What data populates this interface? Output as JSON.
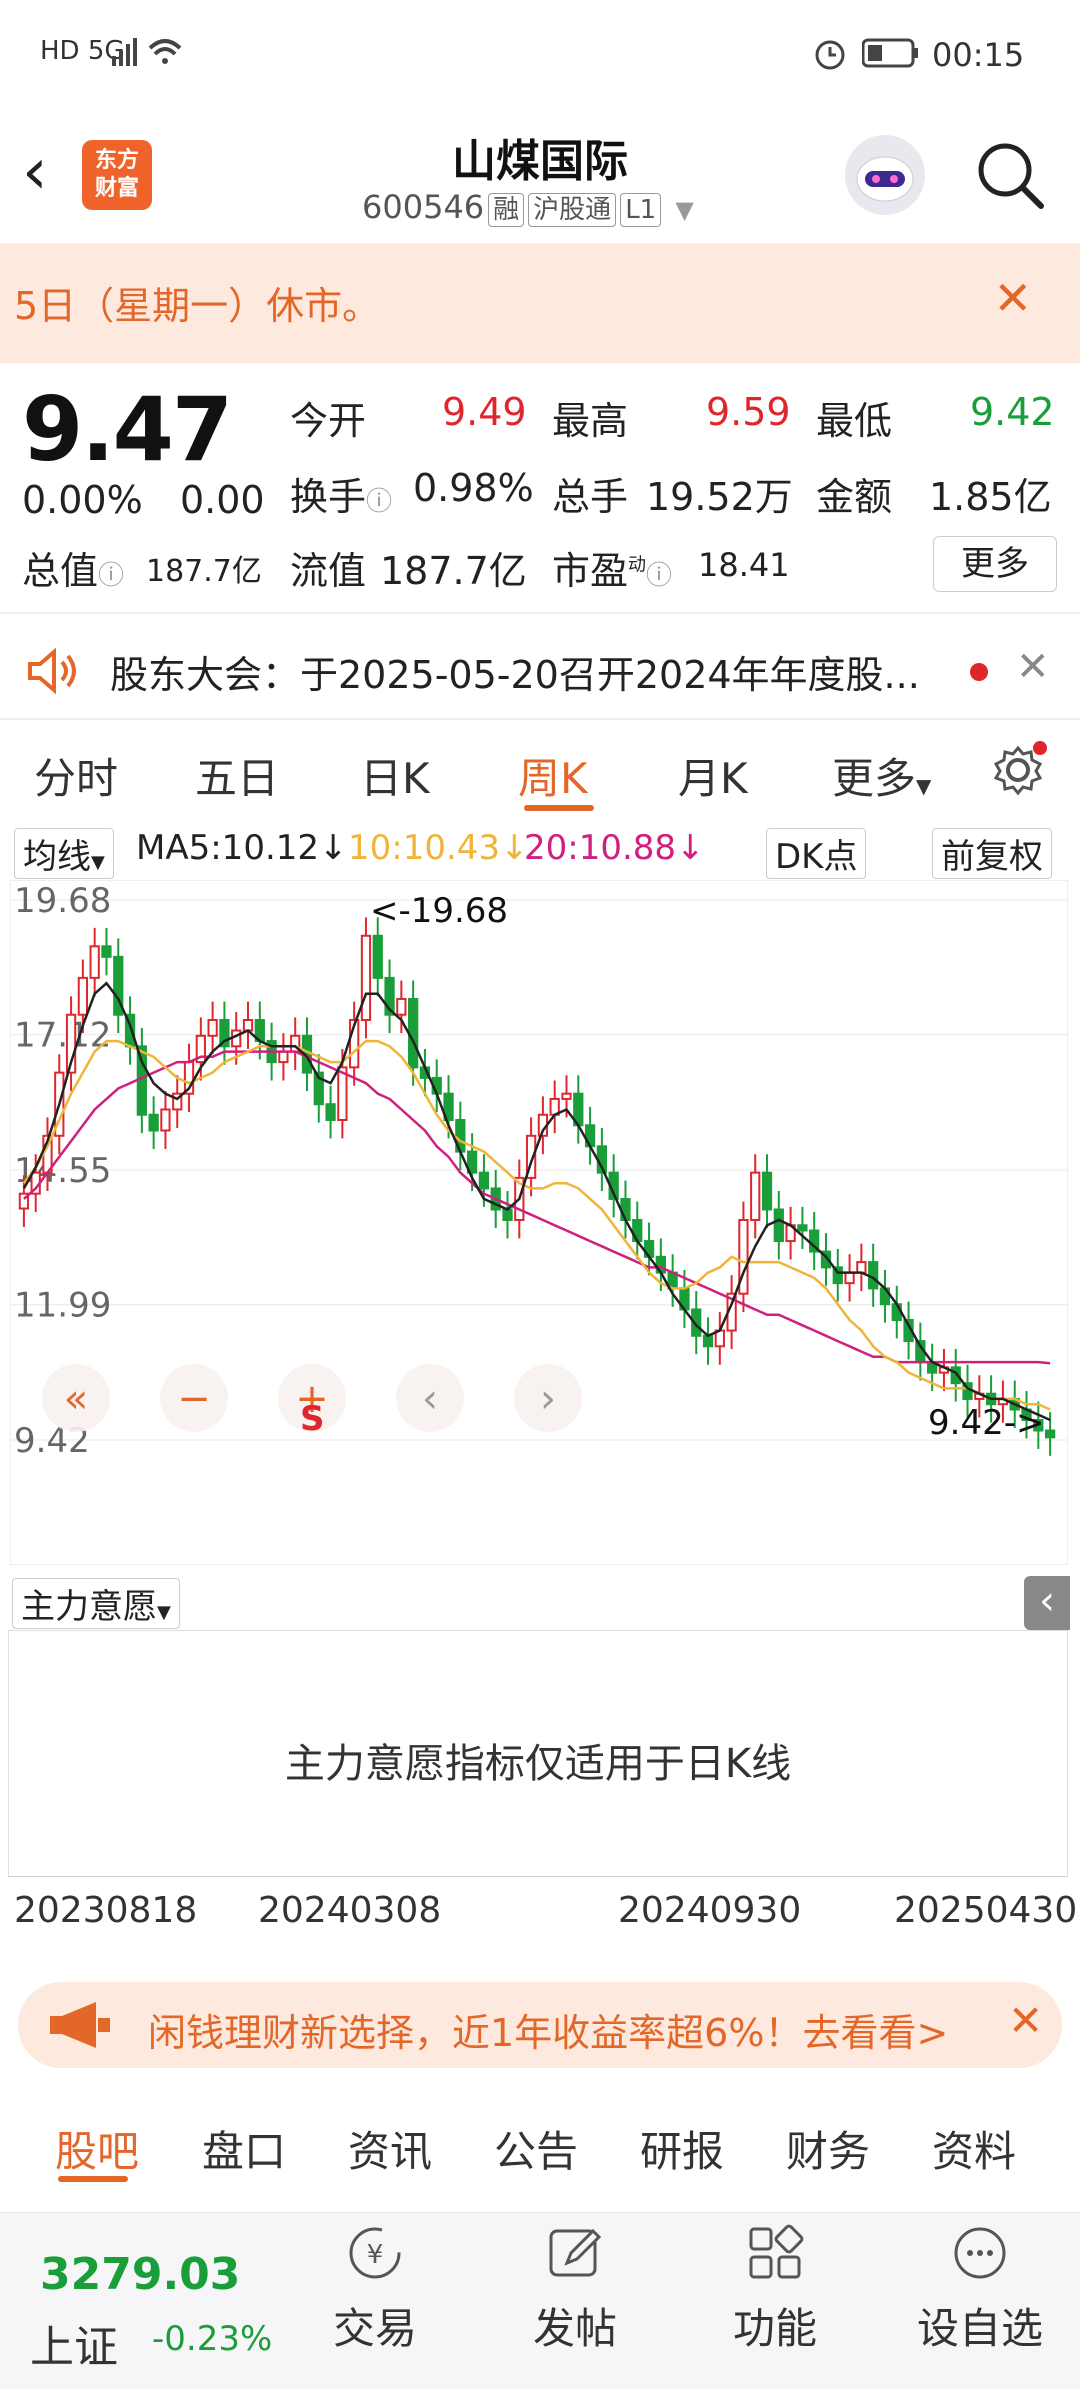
{
  "status_bar": {
    "left": "HD 5G",
    "time": "00:15"
  },
  "header": {
    "logo_line1": "东方",
    "logo_line2": "财富",
    "title": "山煤国际",
    "code": "600546",
    "tags": [
      "融",
      "沪股通",
      "L1"
    ]
  },
  "notice": {
    "text": "5日（星期一）休市。"
  },
  "quote": {
    "price": "9.47",
    "change_pct": "0.00%",
    "change": "0.00",
    "open_label": "今开",
    "open": "9.49",
    "high_label": "最高",
    "high": "9.59",
    "low_label": "最低",
    "low": "9.42",
    "turnover_label": "换手",
    "turnover": "0.98%",
    "volume_label": "总手",
    "volume": "19.52万",
    "amount_label": "金额",
    "amount": "1.85亿",
    "mktcap_label": "总值",
    "mktcap": "187.7亿",
    "float_label": "流值",
    "float": "187.7亿",
    "pe_label": "市盈",
    "pe_sup": "动",
    "pe": "18.41",
    "more": "更多"
  },
  "announcement": {
    "text": "股东大会：于2025-05-20召开2024年年度股..."
  },
  "tabs": [
    "分时",
    "五日",
    "日K",
    "周K",
    "月K",
    "更多"
  ],
  "ma_row": {
    "selector": "均线",
    "ma5": "MA5:10.12",
    "ma10": "10:10.43",
    "ma20": "20:10.88",
    "dk": "DK点",
    "adjust": "前复权"
  },
  "colors": {
    "accent": "#e4672a",
    "up": "#e0262d",
    "down": "#1a9e3a",
    "ma5": "#222222",
    "ma10": "#f0b43a",
    "ma20": "#d0207e"
  },
  "chart_data": {
    "type": "candlestick",
    "y_ticks": [
      "19.68",
      "17.12",
      "14.55",
      "11.99",
      "9.42"
    ],
    "ylim": [
      9.42,
      19.68
    ],
    "max_label": "<-19.68",
    "min_label": "9.42->",
    "close": [
      14.1,
      14.5,
      15.2,
      16.4,
      17.5,
      18.2,
      18.8,
      18.6,
      17.5,
      16.9,
      15.6,
      15.3,
      15.7,
      16.0,
      16.6,
      17.1,
      17.4,
      16.9,
      17.2,
      17.4,
      17.0,
      16.6,
      16.8,
      17.1,
      16.4,
      15.8,
      15.5,
      16.5,
      17.4,
      19.0,
      18.2,
      17.5,
      17.8,
      16.5,
      16.3,
      16.0,
      15.5,
      14.9,
      14.5,
      14.2,
      13.8,
      13.6,
      14.4,
      15.2,
      15.6,
      15.9,
      16.0,
      15.4,
      15.0,
      14.5,
      14.0,
      13.6,
      13.2,
      12.9,
      12.6,
      12.3,
      11.9,
      11.4,
      11.2,
      11.5,
      12.2,
      13.6,
      14.5,
      13.8,
      13.2,
      13.5,
      13.4,
      13.0,
      12.7,
      12.4,
      12.6,
      12.8,
      12.3,
      12.0,
      11.7,
      11.3,
      10.9,
      10.7,
      10.8,
      10.5,
      10.2,
      10.3,
      10.1,
      10.2,
      10.0,
      9.8,
      9.6,
      9.47
    ],
    "ma5": [
      14.2,
      14.6,
      15.1,
      15.8,
      16.6,
      17.3,
      17.9,
      18.1,
      17.8,
      17.3,
      16.6,
      16.2,
      16.0,
      15.9,
      16.1,
      16.5,
      16.8,
      17.0,
      17.1,
      17.2,
      17.0,
      16.9,
      16.9,
      16.9,
      16.7,
      16.3,
      16.2,
      16.6,
      17.3,
      17.9,
      17.9,
      17.6,
      17.4,
      17.0,
      16.5,
      16.0,
      15.4,
      14.9,
      14.4,
      14.0,
      13.9,
      13.8,
      14.0,
      14.7,
      15.3,
      15.6,
      15.7,
      15.4,
      15.0,
      14.6,
      14.1,
      13.6,
      13.2,
      12.9,
      12.6,
      12.2,
      11.9,
      11.6,
      11.4,
      11.5,
      12.0,
      12.6,
      13.1,
      13.5,
      13.6,
      13.5,
      13.3,
      13.1,
      12.9,
      12.6,
      12.6,
      12.6,
      12.5,
      12.3,
      12.0,
      11.6,
      11.2,
      10.9,
      10.8,
      10.7,
      10.4,
      10.3,
      10.2,
      10.2,
      10.1,
      10.0,
      9.9,
      9.8
    ],
    "ma10": [
      14.3,
      14.6,
      15.0,
      15.5,
      16.0,
      16.4,
      16.8,
      17.0,
      17.0,
      16.9,
      16.8,
      16.7,
      16.5,
      16.3,
      16.2,
      16.3,
      16.4,
      16.6,
      16.7,
      16.8,
      16.9,
      16.9,
      16.9,
      16.9,
      16.8,
      16.7,
      16.6,
      16.6,
      16.8,
      17.0,
      17.0,
      16.9,
      16.7,
      16.4,
      16.0,
      15.6,
      15.3,
      15.1,
      15.0,
      14.9,
      14.7,
      14.5,
      14.3,
      14.2,
      14.2,
      14.3,
      14.3,
      14.2,
      14.0,
      13.8,
      13.5,
      13.2,
      12.9,
      12.6,
      12.4,
      12.3,
      12.3,
      12.4,
      12.6,
      12.7,
      12.9,
      12.8,
      12.8,
      12.8,
      12.8,
      12.7,
      12.6,
      12.5,
      12.3,
      12.0,
      11.7,
      11.5,
      11.2,
      11.0,
      10.9,
      10.7,
      10.6,
      10.5,
      10.4,
      10.4,
      10.4,
      10.3,
      10.2,
      10.2,
      10.2,
      10.1,
      10.1,
      10.0
    ],
    "ma20": [
      14.0,
      14.2,
      14.5,
      14.8,
      15.1,
      15.4,
      15.7,
      15.9,
      16.1,
      16.2,
      16.3,
      16.4,
      16.5,
      16.6,
      16.6,
      16.7,
      16.7,
      16.8,
      16.8,
      16.8,
      16.8,
      16.8,
      16.8,
      16.8,
      16.7,
      16.6,
      16.5,
      16.4,
      16.3,
      16.2,
      16.0,
      15.9,
      15.7,
      15.5,
      15.3,
      15.0,
      14.8,
      14.5,
      14.3,
      14.1,
      14.0,
      13.9,
      13.8,
      13.7,
      13.6,
      13.5,
      13.4,
      13.3,
      13.2,
      13.1,
      13.0,
      12.9,
      12.8,
      12.7,
      12.7,
      12.6,
      12.5,
      12.4,
      12.3,
      12.2,
      12.1,
      12.0,
      11.9,
      11.8,
      11.8,
      11.7,
      11.6,
      11.5,
      11.4,
      11.3,
      11.2,
      11.1,
      11.0,
      11.0,
      10.9,
      10.9,
      10.9,
      10.9,
      10.9,
      10.9,
      10.9,
      10.9,
      10.9,
      10.9,
      10.9,
      10.9,
      10.9,
      10.88
    ]
  },
  "chart_controls": [
    "«",
    "−",
    "+",
    "‹",
    "›"
  ],
  "indicator": {
    "selector": "主力意愿",
    "message": "主力意愿指标仅适用于日K线"
  },
  "dates": [
    "20230818",
    "20240308",
    "20240930",
    "20250430"
  ],
  "ad": {
    "text": "闲钱理财新选择，近1年收益率超6%！去看看>"
  },
  "bottom_tabs": [
    "股吧",
    "盘口",
    "资讯",
    "公告",
    "研报",
    "财务",
    "资料"
  ],
  "footer": {
    "index_value": "3279.03",
    "index_name": "上证",
    "index_change": "-0.23%",
    "buttons": [
      "交易",
      "发帖",
      "功能",
      "设自选"
    ]
  }
}
